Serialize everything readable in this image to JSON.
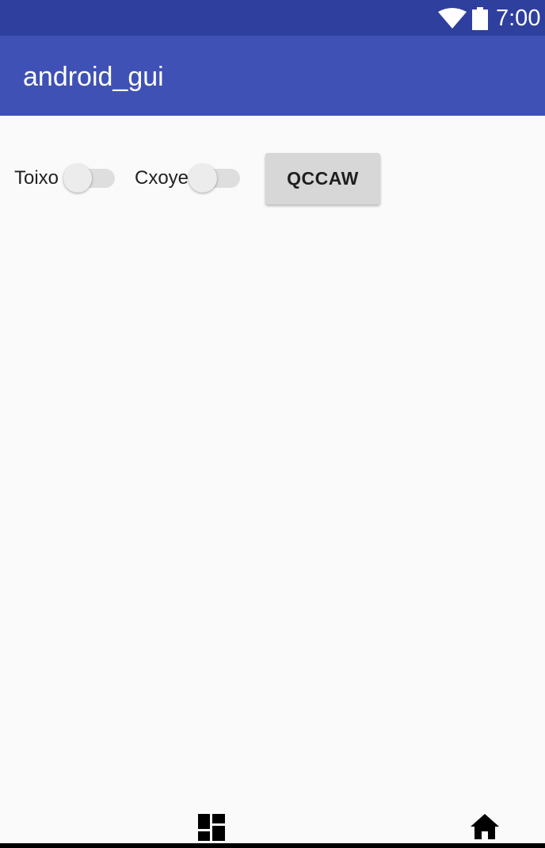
{
  "status_bar": {
    "time": "7:00",
    "icons": [
      "wifi-icon",
      "battery-icon"
    ],
    "color": "#2f3f9e"
  },
  "app_bar": {
    "title": "android_gui",
    "color": "#3f51b5"
  },
  "controls": {
    "switches": [
      {
        "label": "Toixo",
        "checked": false
      },
      {
        "label": "Cxoye",
        "checked": false
      }
    ],
    "button_label": "QCCAW"
  },
  "bottom_nav": {
    "icons": [
      "overview-icon",
      "home-icon"
    ]
  }
}
